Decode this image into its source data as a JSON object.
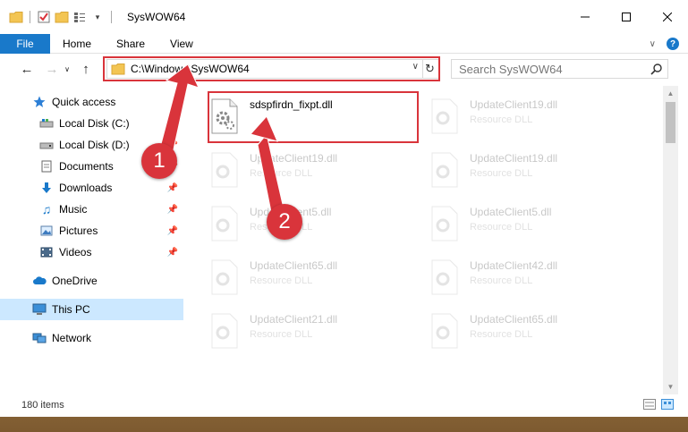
{
  "window": {
    "title": "SysWOW64",
    "controls": {
      "minimize_icon": "minimize-icon",
      "maximize_icon": "maximize-icon",
      "close_icon": "close-icon"
    }
  },
  "ribbon": {
    "tabs": [
      "File",
      "Home",
      "Share",
      "View"
    ],
    "active_tab": "File",
    "accent": "#1979ca"
  },
  "navbar": {
    "address": "C:\\Windows\\SysWOW64",
    "search_placeholder": "Search SysWOW64"
  },
  "sidebar": {
    "items": [
      {
        "label": "Quick access",
        "icon": "star-icon"
      },
      {
        "label": "Local Disk (C:)",
        "icon": "drive-icon",
        "pinned": true
      },
      {
        "label": "Local Disk (D:)",
        "icon": "drive-icon",
        "pinned": true
      },
      {
        "label": "Documents",
        "icon": "documents-icon",
        "pinned": true
      },
      {
        "label": "Downloads",
        "icon": "download-icon",
        "pinned": true
      },
      {
        "label": "Music",
        "icon": "music-icon",
        "pinned": true
      },
      {
        "label": "Pictures",
        "icon": "pictures-icon",
        "pinned": true
      },
      {
        "label": "Videos",
        "icon": "videos-icon",
        "pinned": true
      },
      {
        "label": "OneDrive",
        "icon": "cloud-icon"
      },
      {
        "label": "This PC",
        "icon": "computer-icon",
        "selected": true
      },
      {
        "label": "Network",
        "icon": "network-icon"
      }
    ]
  },
  "files": [
    {
      "name": "sdspfirdn_fixpt.dll",
      "type": "",
      "highlighted": true
    },
    {
      "name": "UpdateClient19.dll",
      "type": "Resource DLL"
    },
    {
      "name": "UpdateClient19.dll",
      "type": "Resource DLL"
    },
    {
      "name": "UpdateClient19.dll",
      "type": "Resource DLL"
    },
    {
      "name": "UpdateClient5.dll",
      "type": "Resource DLL"
    },
    {
      "name": "UpdateClient5.dll",
      "type": "Resource DLL"
    },
    {
      "name": "UpdateClient65.dll",
      "type": "Resource DLL"
    },
    {
      "name": "UpdateClient42.dll",
      "type": "Resource DLL"
    },
    {
      "name": "UpdateClient21.dll",
      "type": "Resource DLL"
    },
    {
      "name": "UpdateClient65.dll",
      "type": "Resource DLL"
    }
  ],
  "status": {
    "item_count": "180 items"
  },
  "annotations": {
    "step1": "1",
    "step2": "2",
    "color": "#d9343b"
  }
}
